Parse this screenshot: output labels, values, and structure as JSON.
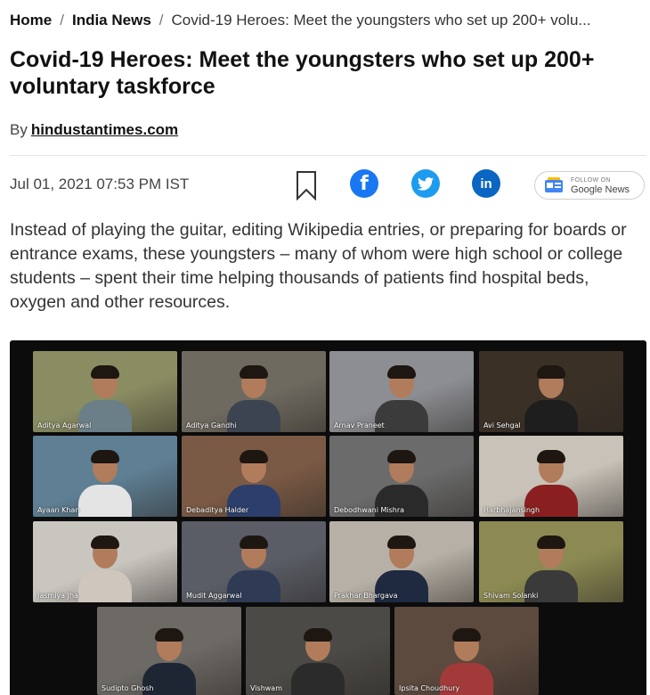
{
  "breadcrumb": {
    "home": "Home",
    "section": "India News",
    "current": "Covid-19 Heroes: Meet the youngsters who set up 200+ volu..."
  },
  "article": {
    "headline": "Covid-19 Heroes: Meet the youngsters who set up 200+ voluntary taskforce",
    "byline_prefix": "By",
    "author": "hindustantimes.com",
    "date": "Jul 01, 2021 07:53 PM IST",
    "summary": "Instead of playing the guitar, editing Wikipedia entries, or preparing for boards or entrance exams, these youngsters – many of whom were high school or college students – spent their time helping thousands of patients find hospital beds, oxygen and other resources."
  },
  "share": {
    "bookmark_icon": "bookmark-icon",
    "facebook_icon": "facebook-icon",
    "twitter_icon": "twitter-icon",
    "linkedin_icon": "linkedin-icon",
    "linkedin_glyph": "in",
    "facebook_glyph": "f"
  },
  "google_news": {
    "follow_on": "FOLLOW ON",
    "google": "Google",
    "news": "News"
  },
  "video_call": {
    "participants": [
      "Aditya Agarwal",
      "Aditya Gandhi",
      "Arnav Praneet",
      "Avi Sehgal",
      "Ayaan Khan",
      "Debaditya Halder",
      "Debodhwani Mishra",
      "Harbhajansingh",
      "Jasmiya Jha",
      "Mudit Aggarwal",
      "Prakhar Bhargava",
      "Shivam Solanki",
      "Sudipto Ghosh",
      "Vishwam",
      "Ipsita Choudhury"
    ]
  },
  "colors": {
    "facebook": "#1877f2",
    "twitter": "#1d9bf0",
    "linkedin": "#0a66c2",
    "call_background": "#0c0c0c"
  }
}
